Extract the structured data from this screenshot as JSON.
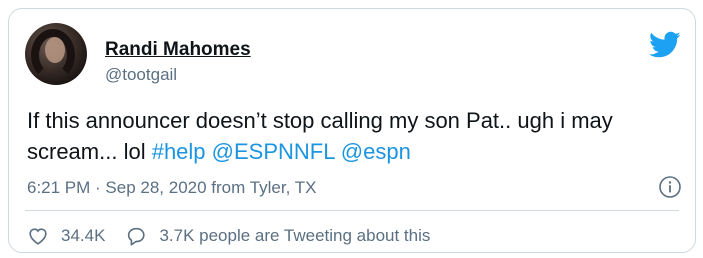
{
  "tweet": {
    "author_name": "Randi Mahomes",
    "author_handle": "@tootgail",
    "text_plain": "If this announcer doesn’t stop calling my son Pat.. ugh i may scream... lol ",
    "hashtag": "#help",
    "mention_1": "@ESPNNFL",
    "mention_2": "@espn",
    "timestamp": "6:21 PM · Sep 28, 2020 from Tyler, TX",
    "like_count": "34.4K",
    "tweeting_about": "3.7K people are Tweeting about this"
  },
  "icons": {
    "brand": "twitter-bird-icon",
    "info": "info-icon",
    "like": "heart-icon",
    "reply": "speech-bubble-icon"
  },
  "colors": {
    "link": "#1b95e0",
    "twitter_blue": "#1da1f2",
    "secondary_text": "#5b7083"
  }
}
